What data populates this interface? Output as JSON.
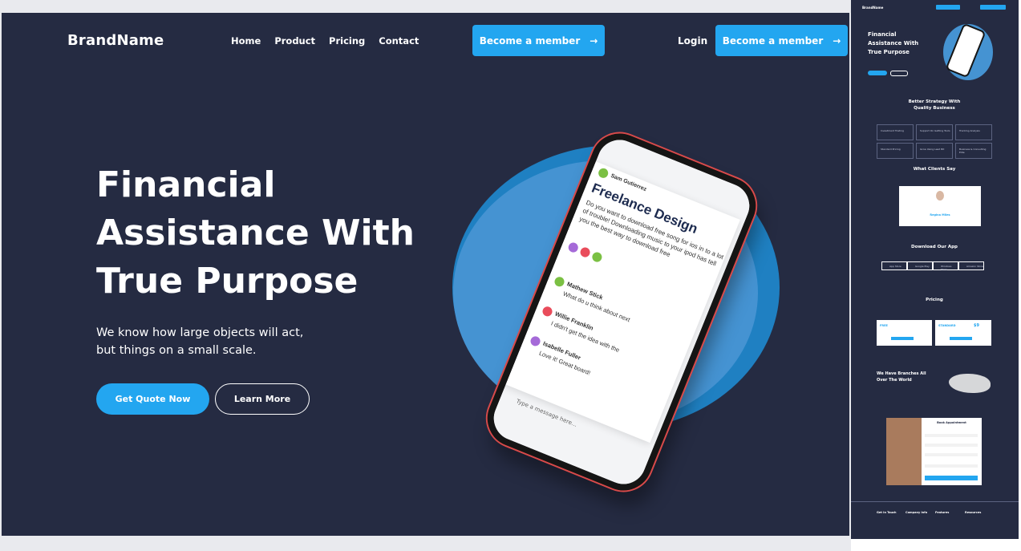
{
  "brand": "BrandName",
  "nav": [
    "Home",
    "Product",
    "Pricing",
    "Contact"
  ],
  "cta_member": "Become a member",
  "arrow": "→",
  "login": "Login",
  "hero": {
    "title_lines": [
      "Financial",
      "Assistance With",
      "True Purpose"
    ],
    "subtitle_lines": [
      "We know how large objects will act,",
      "but things on a small scale."
    ],
    "primary_button": "Get Quote Now",
    "secondary_button": "Learn More"
  },
  "phone": {
    "card_name": "Sam Gutierrez",
    "card_title": "Freelance Design",
    "card_body": "Do you want to download free song for ios in to a lot of trouble! Downloading music to your ipod has tell you the best way to download free",
    "messages": [
      {
        "name": "Mathew Stick",
        "text": "What do u think about next"
      },
      {
        "name": "Willie Franklin",
        "text": "I didn't get the idea with the"
      },
      {
        "name": "Isabelle Fuller",
        "text": "Love it! Great board!"
      }
    ],
    "typing": "Type a message here..."
  },
  "thumbnail": {
    "brand": "BrandName",
    "hero_title_lines": [
      "Financial",
      "Assistance With",
      "True Purpose"
    ],
    "strategy_title": [
      "Better Strategy With",
      "Quality Business"
    ],
    "services": [
      "Investment Trading",
      "Support On Getting Tools",
      "Tracking Analysis",
      "Standard Pricing",
      "Grow Using Lead Bit",
      "Business & Consulting Elite"
    ],
    "clients_title": "What Clients Say",
    "client_name": "Regina Miles",
    "download_title": "Download Our App",
    "stores": [
      "App Store",
      "Google Play",
      "Windows Store",
      "Amazon Store"
    ],
    "pricing_title": "Pricing",
    "plans": [
      "FREE",
      "STANDARD"
    ],
    "plan_price": "$9",
    "branches_title": [
      "We Have Branches All",
      "Over The World"
    ],
    "appointment_title": "Book Appointment",
    "footer_cols": [
      "Get In Touch",
      "Company info",
      "Features",
      "Resources"
    ]
  },
  "colors": {
    "bg": "#252b42",
    "accent": "#23a6f0",
    "blob_dark": "#1f80c2",
    "blob_light": "#4593d2"
  }
}
